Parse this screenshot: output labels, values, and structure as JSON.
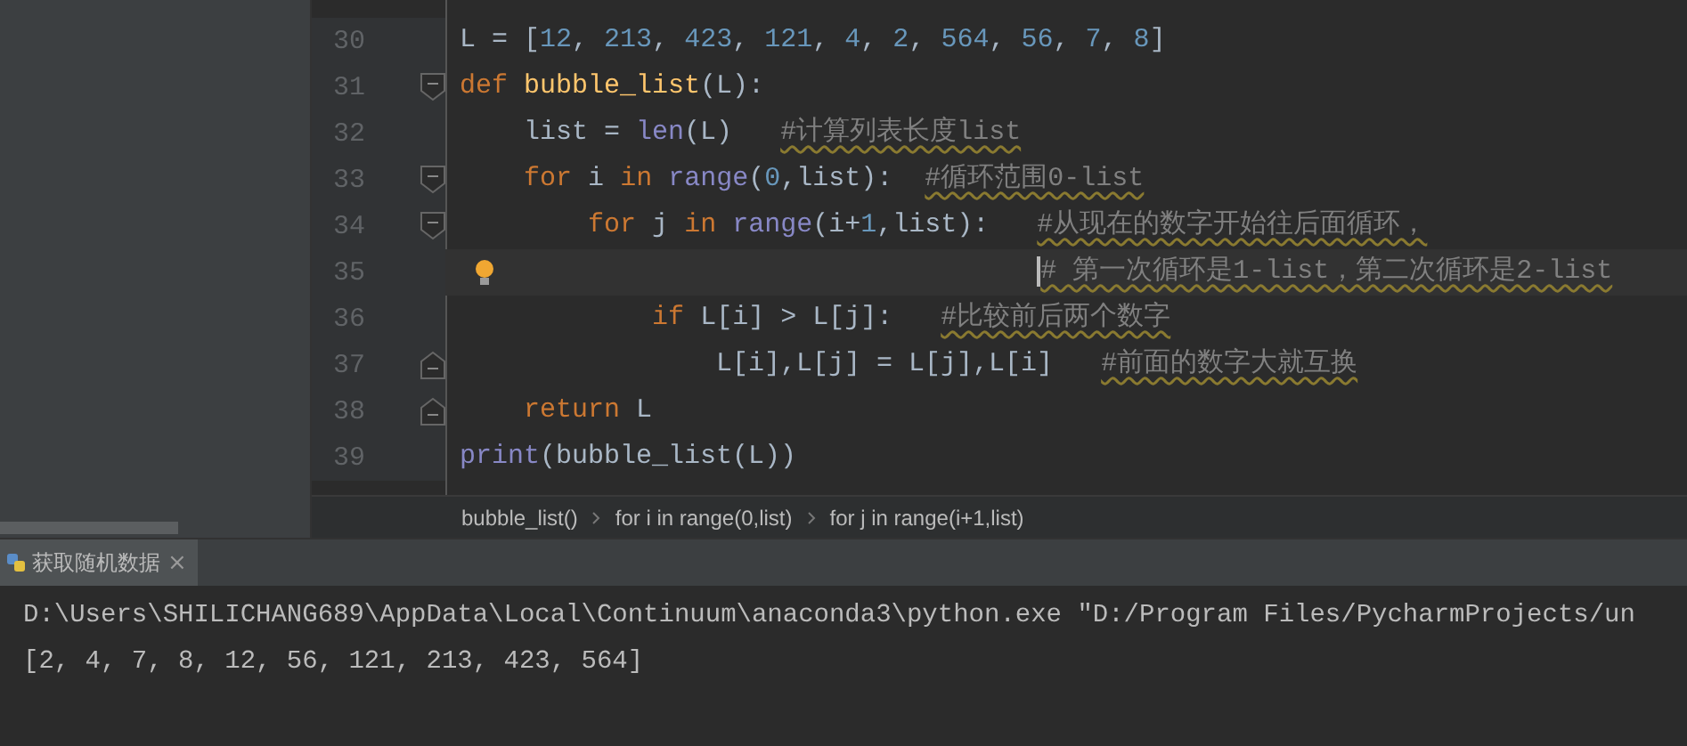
{
  "editor": {
    "lines": [
      {
        "number": "30",
        "fold_start": false,
        "fold_end": false,
        "current": false,
        "bulb": false,
        "tokens": [
          {
            "kind": "plain",
            "text": "L = ["
          },
          {
            "kind": "num",
            "text": "12"
          },
          {
            "kind": "plain",
            "text": ", "
          },
          {
            "kind": "num",
            "text": "213"
          },
          {
            "kind": "plain",
            "text": ", "
          },
          {
            "kind": "num",
            "text": "423"
          },
          {
            "kind": "plain",
            "text": ", "
          },
          {
            "kind": "num",
            "text": "121"
          },
          {
            "kind": "plain",
            "text": ", "
          },
          {
            "kind": "num",
            "text": "4"
          },
          {
            "kind": "plain",
            "text": ", "
          },
          {
            "kind": "num",
            "text": "2"
          },
          {
            "kind": "plain",
            "text": ", "
          },
          {
            "kind": "num",
            "text": "564"
          },
          {
            "kind": "plain",
            "text": ", "
          },
          {
            "kind": "num",
            "text": "56"
          },
          {
            "kind": "plain",
            "text": ", "
          },
          {
            "kind": "num",
            "text": "7"
          },
          {
            "kind": "plain",
            "text": ", "
          },
          {
            "kind": "num",
            "text": "8"
          },
          {
            "kind": "plain",
            "text": "]"
          }
        ]
      },
      {
        "number": "31",
        "fold_start": true,
        "fold_end": false,
        "current": false,
        "bulb": false,
        "tokens": [
          {
            "kind": "kw",
            "text": "def "
          },
          {
            "kind": "defname",
            "text": "bubble_list"
          },
          {
            "kind": "plain",
            "text": "(L):"
          }
        ]
      },
      {
        "number": "32",
        "fold_start": false,
        "fold_end": false,
        "current": false,
        "bulb": false,
        "tokens": [
          {
            "kind": "plain",
            "text": "    list = "
          },
          {
            "kind": "builtin",
            "text": "len"
          },
          {
            "kind": "plain",
            "text": "(L)   "
          },
          {
            "kind": "comment",
            "text": "#计算列表长度list"
          }
        ]
      },
      {
        "number": "33",
        "fold_start": true,
        "fold_end": false,
        "current": false,
        "bulb": false,
        "tokens": [
          {
            "kind": "kw",
            "text": "    for"
          },
          {
            "kind": "plain",
            "text": " i "
          },
          {
            "kind": "kw",
            "text": "in"
          },
          {
            "kind": "builtin",
            "text": " range"
          },
          {
            "kind": "plain",
            "text": "("
          },
          {
            "kind": "num",
            "text": "0"
          },
          {
            "kind": "plain",
            "text": ",list):  "
          },
          {
            "kind": "comment",
            "text": "#循环范围0-list"
          }
        ]
      },
      {
        "number": "34",
        "fold_start": true,
        "fold_end": false,
        "current": false,
        "bulb": false,
        "tokens": [
          {
            "kind": "kw",
            "text": "        for"
          },
          {
            "kind": "plain",
            "text": " j "
          },
          {
            "kind": "kw",
            "text": "in"
          },
          {
            "kind": "builtin",
            "text": " range"
          },
          {
            "kind": "plain",
            "text": "(i+"
          },
          {
            "kind": "num",
            "text": "1"
          },
          {
            "kind": "plain",
            "text": ",list):   "
          },
          {
            "kind": "comment",
            "text": "#从现在的数字开始往后面循环，"
          }
        ]
      },
      {
        "number": "35",
        "fold_start": false,
        "fold_end": false,
        "current": true,
        "bulb": true,
        "tokens": [
          {
            "kind": "comment",
            "text": "                                    # 第一次循环是1-list，第二次循环是2-list"
          }
        ]
      },
      {
        "number": "36",
        "fold_start": false,
        "fold_end": false,
        "current": false,
        "bulb": false,
        "tokens": [
          {
            "kind": "kw",
            "text": "            if"
          },
          {
            "kind": "plain",
            "text": " L[i] > L[j]:   "
          },
          {
            "kind": "comment",
            "text": "#比较前后两个数字"
          }
        ]
      },
      {
        "number": "37",
        "fold_start": false,
        "fold_end": true,
        "current": false,
        "bulb": false,
        "tokens": [
          {
            "kind": "plain",
            "text": "                L[i],L[j] = L[j],L[i]   "
          },
          {
            "kind": "comment",
            "text": "#前面的数字大就互换"
          }
        ]
      },
      {
        "number": "38",
        "fold_start": false,
        "fold_end": true,
        "current": false,
        "bulb": false,
        "tokens": [
          {
            "kind": "kw",
            "text": "    return"
          },
          {
            "kind": "plain",
            "text": " L"
          }
        ]
      },
      {
        "number": "39",
        "fold_start": false,
        "fold_end": false,
        "current": false,
        "bulb": false,
        "tokens": [
          {
            "kind": "builtin",
            "text": "print"
          },
          {
            "kind": "plain",
            "text": "(bubble_list(L))"
          }
        ]
      }
    ]
  },
  "breadcrumbs": [
    "bubble_list()",
    "for i in range(0,list)",
    "for j in range(i+1,list)"
  ],
  "run_panel": {
    "tab": {
      "label": "获取随机数据",
      "selected": true,
      "close": "×"
    },
    "output": [
      "D:\\Users\\SHILICHANG689\\AppData\\Local\\Continuum\\anaconda3\\python.exe \"D:/Program Files/PycharmProjects/un",
      "[2, 4, 7, 8, 12, 56, 121, 213, 423, 564]"
    ]
  }
}
